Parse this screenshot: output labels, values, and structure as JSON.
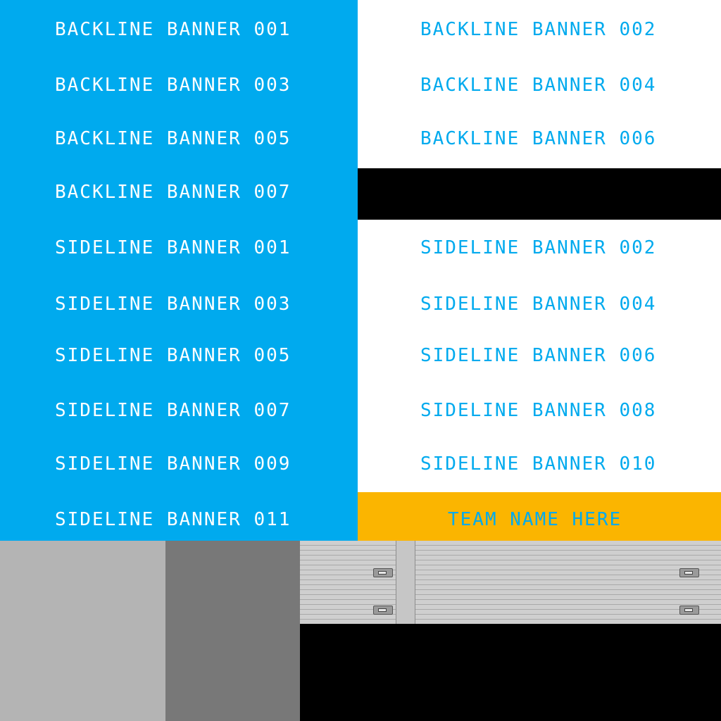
{
  "backline_banners": {
    "b001": "BACKLINE BANNER 001",
    "b002": "BACKLINE BANNER 002",
    "b003": "BACKLINE BANNER 003",
    "b004": "BACKLINE BANNER 004",
    "b005": "BACKLINE BANNER 005",
    "b006": "BACKLINE BANNER 006",
    "b007": "BACKLINE BANNER 007"
  },
  "sideline_banners": {
    "s001": "SIDELINE BANNER 001",
    "s002": "SIDELINE BANNER 002",
    "s003": "SIDELINE BANNER 003",
    "s004": "SIDELINE BANNER 004",
    "s005": "SIDELINE BANNER 005",
    "s006": "SIDELINE BANNER 006",
    "s007": "SIDELINE BANNER 007",
    "s008": "SIDELINE BANNER 008",
    "s009": "SIDELINE BANNER 009",
    "s010": "SIDELINE BANNER 010",
    "s011": "SIDELINE BANNER 011"
  },
  "team_name_placeholder": "TEAM NAME HERE",
  "colors": {
    "blue": "#00aaee",
    "white": "#ffffff",
    "orange": "#fbb500",
    "black": "#000000",
    "light_gray": "#b4b4b4",
    "dark_gray": "#787878"
  }
}
